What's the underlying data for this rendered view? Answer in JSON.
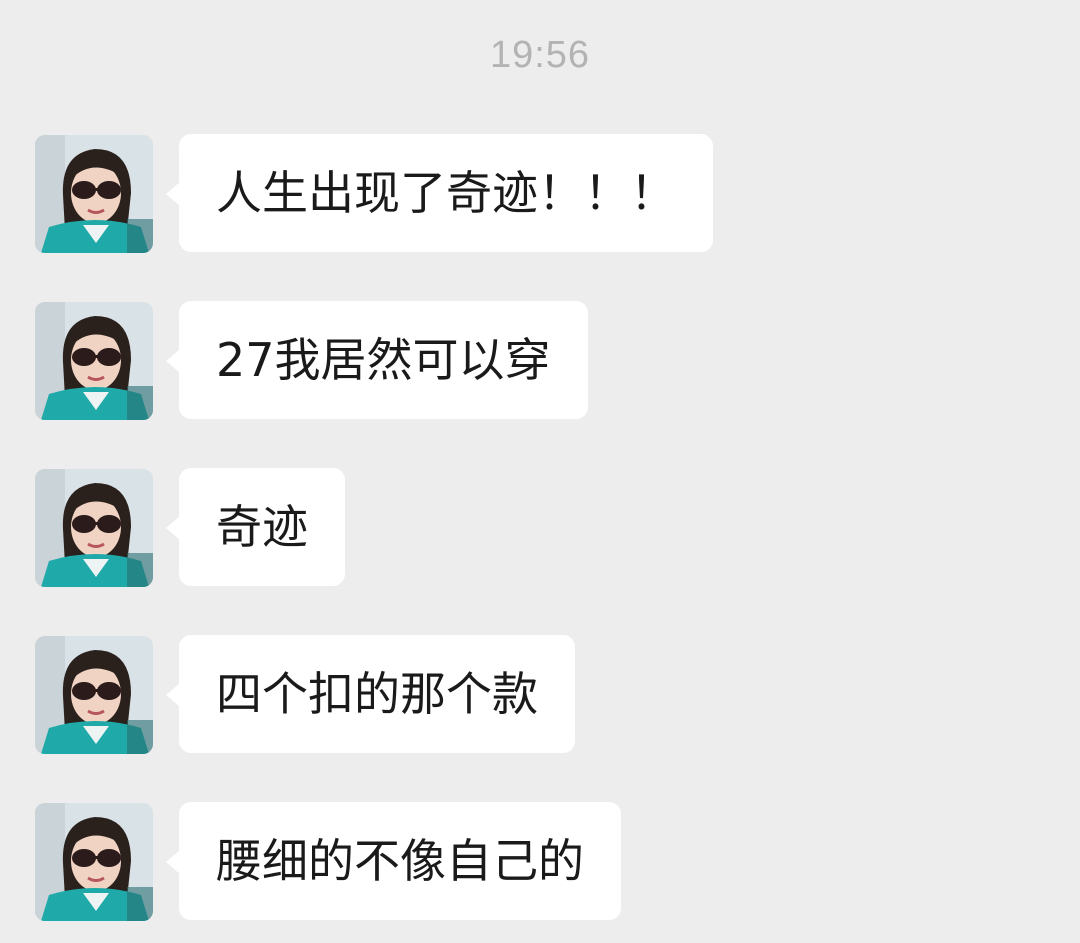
{
  "chat": {
    "timestamp": "19:56",
    "messages": [
      {
        "text": "人生出现了奇迹！！！",
        "avatar_icon": "user-avatar"
      },
      {
        "text": "27我居然可以穿",
        "avatar_icon": "user-avatar"
      },
      {
        "text": "奇迹",
        "avatar_icon": "user-avatar"
      },
      {
        "text": "四个扣的那个款",
        "avatar_icon": "user-avatar"
      },
      {
        "text": "腰细的不像自己的",
        "avatar_icon": "user-avatar"
      }
    ]
  },
  "colors": {
    "background": "#ededed",
    "bubble": "#ffffff",
    "timestamp": "#b3b3b3",
    "text": "#1a1a1a",
    "avatar_shirt": "#1fa9a8"
  }
}
